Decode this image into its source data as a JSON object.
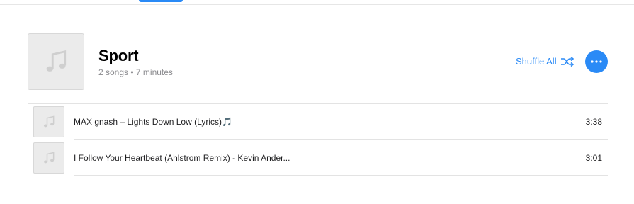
{
  "playlist": {
    "title": "Sport",
    "meta": "2 songs • 7 minutes"
  },
  "actions": {
    "shuffle_label": "Shuffle All"
  },
  "tracks": [
    {
      "title": "MAX gnash – Lights Down Low (Lyrics)🎵",
      "duration": "3:38"
    },
    {
      "title": "I Follow Your Heartbeat (Ahlstrom Remix) - Kevin Ander...",
      "duration": "3:01"
    }
  ],
  "icons": {
    "artwork": "music-note-icon",
    "shuffle": "shuffle-icon",
    "more": "more-dots-icon"
  },
  "colors": {
    "accent": "#2a8af6",
    "placeholder_bg": "#ebebeb",
    "secondary_text": "#8a8a8e"
  }
}
